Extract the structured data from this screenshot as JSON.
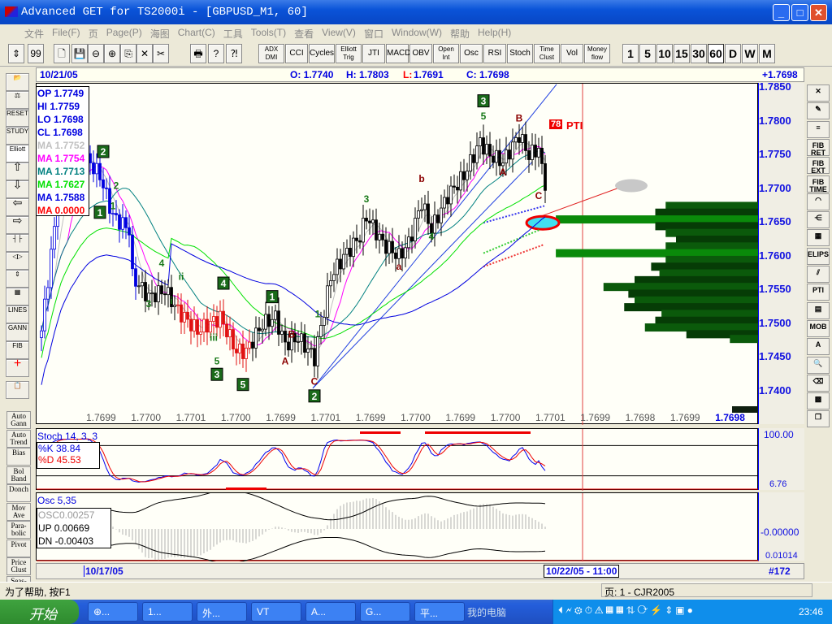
{
  "window": {
    "title": "Advanced GET for TS2000i - [GBPUSD_M1, 60]"
  },
  "menu": [
    "文件",
    "File(F)",
    "页",
    "Page(P)",
    "海图",
    "Chart(C)",
    "工具",
    "Tools(T)",
    "查看",
    "View(V)",
    "窗口",
    "Window(W)",
    "帮助",
    "Help(H)"
  ],
  "toolbar": {
    "indicators": [
      "ADX DMI",
      "CCI",
      "Cycles",
      "Elliott Trig",
      "JTI",
      "MACD",
      "OBV",
      "Open Int",
      "Osc",
      "RSI",
      "Stoch",
      "Time Clust",
      "Vol",
      "Money flow"
    ],
    "periods": [
      "1",
      "5",
      "10",
      "15",
      "30",
      "60",
      "D",
      "W",
      "M"
    ],
    "active_period": "60"
  },
  "info": {
    "date": "10/21/05",
    "open": "O: 1.7740",
    "high": "H: 1.7803",
    "low_label": "L:",
    "low": "1.7691",
    "close": "C: 1.7698",
    "change": "+1.7698"
  },
  "legend": [
    {
      "label": "OP 1.7749",
      "color": "#0000e0"
    },
    {
      "label": "HI  1.7759",
      "color": "#0000e0"
    },
    {
      "label": "LO  1.7698",
      "color": "#0000e0"
    },
    {
      "label": "CL  1.7698",
      "color": "#0000e0"
    },
    {
      "label": "MA 1.7752",
      "color": "#c0c0c0"
    },
    {
      "label": "MA 1.7754",
      "color": "#ff00ff"
    },
    {
      "label": "MA 1.7713",
      "color": "#008080"
    },
    {
      "label": "MA 1.7627",
      "color": "#00e000"
    },
    {
      "label": "MA 1.7588",
      "color": "#0000e0"
    },
    {
      "label": "MA 0.0000",
      "color": "#ff0000"
    }
  ],
  "left_tools": [
    "Elliott",
    "LINES",
    "GANN",
    "FIB",
    "RESET",
    "STUDY"
  ],
  "left_studies": [
    "Auto Gann",
    "Auto Trend",
    "Bias",
    "Bol Band",
    "Donch",
    "Mov Ave",
    "Para- bolic",
    "Pivot",
    "Price Clust",
    "Seas-"
  ],
  "right_tools": [
    "FIB RET",
    "FIB EXT",
    "FIB TIME",
    "ELIPS",
    "PTI",
    "MOB",
    "A"
  ],
  "pti": {
    "value": "78",
    "label": "PTI"
  },
  "chart_data": {
    "type": "candlestick",
    "symbol": "GBPUSD_M1",
    "interval": "60",
    "ylim": [
      1.7375,
      1.786
    ],
    "price_ticks": [
      "1.7850",
      "1.7800",
      "1.7750",
      "1.7700",
      "1.7650",
      "1.7600",
      "1.7550",
      "1.7500",
      "1.7450",
      "1.7400"
    ],
    "close_keypoints": [
      [
        0,
        1.749
      ],
      [
        5,
        1.768
      ],
      [
        13,
        1.775
      ],
      [
        18,
        1.772
      ],
      [
        22,
        1.766
      ],
      [
        27,
        1.764
      ],
      [
        28,
        1.757
      ],
      [
        33,
        1.754
      ],
      [
        38,
        1.755
      ],
      [
        42,
        1.752
      ],
      [
        48,
        1.749
      ],
      [
        55,
        1.751
      ],
      [
        60,
        1.746
      ],
      [
        63,
        1.746
      ],
      [
        68,
        1.75
      ],
      [
        72,
        1.751
      ],
      [
        75,
        1.747
      ],
      [
        79,
        1.748
      ],
      [
        84,
        1.745
      ],
      [
        87,
        1.752
      ],
      [
        89,
        1.757
      ],
      [
        93,
        1.76
      ],
      [
        98,
        1.763
      ],
      [
        100,
        1.766
      ],
      [
        105,
        1.762
      ],
      [
        110,
        1.76
      ],
      [
        113,
        1.762
      ],
      [
        117,
        1.768
      ],
      [
        120,
        1.764
      ],
      [
        125,
        1.769
      ],
      [
        130,
        1.772
      ],
      [
        135,
        1.777
      ],
      [
        138,
        1.775
      ],
      [
        142,
        1.774
      ],
      [
        147,
        1.778
      ],
      [
        150,
        1.775
      ],
      [
        153,
        1.776
      ],
      [
        155,
        1.7698
      ]
    ],
    "ma_periods": [
      5,
      9,
      22,
      45,
      70
    ],
    "wave_labels": [
      {
        "t": "2",
        "bar": 19,
        "p": 1.7755,
        "box": true
      },
      {
        "t": "1",
        "bar": 18,
        "p": 1.7665,
        "box": true
      },
      {
        "t": "1",
        "bar": 22,
        "p": 1.7675,
        "box": false
      },
      {
        "t": "2",
        "bar": 23,
        "p": 1.7705,
        "box": false
      },
      {
        "t": "4",
        "bar": 37,
        "p": 1.759,
        "box": false
      },
      {
        "t": "ii",
        "bar": 43,
        "p": 1.757,
        "box": false
      },
      {
        "t": "3",
        "bar": 33,
        "p": 1.753,
        "box": false
      },
      {
        "t": "i",
        "bar": 40,
        "p": 1.7535,
        "box": false
      },
      {
        "t": "4",
        "bar": 56,
        "p": 1.756,
        "box": true
      },
      {
        "t": "iii",
        "bar": 53,
        "p": 1.748,
        "box": false
      },
      {
        "t": "5",
        "bar": 54,
        "p": 1.7445,
        "box": false
      },
      {
        "t": "3",
        "bar": 54,
        "p": 1.7425,
        "box": true
      },
      {
        "t": "5",
        "bar": 62,
        "p": 1.741,
        "box": true
      },
      {
        "t": "1",
        "bar": 71,
        "p": 1.754,
        "box": true
      },
      {
        "t": "B",
        "bar": 77,
        "p": 1.7485,
        "box": false
      },
      {
        "t": "A",
        "bar": 75,
        "p": 1.7445,
        "box": false
      },
      {
        "t": "1",
        "bar": 85,
        "p": 1.7515,
        "box": false
      },
      {
        "t": "C",
        "bar": 84,
        "p": 1.7415,
        "box": false
      },
      {
        "t": "2",
        "bar": 84,
        "p": 1.7393,
        "box": true
      },
      {
        "t": "3",
        "bar": 100,
        "p": 1.7685,
        "box": false
      },
      {
        "t": "a",
        "bar": 110,
        "p": 1.7585,
        "box": false
      },
      {
        "t": "4",
        "bar": 120,
        "p": 1.763,
        "box": false
      },
      {
        "t": "b",
        "bar": 117,
        "p": 1.7715,
        "box": false
      },
      {
        "t": "3",
        "bar": 136,
        "p": 1.783,
        "box": true
      },
      {
        "t": "5",
        "bar": 136,
        "p": 1.7808,
        "box": false
      },
      {
        "t": "A",
        "bar": 142,
        "p": 1.7725,
        "box": false
      },
      {
        "t": "B",
        "bar": 147,
        "p": 1.7805,
        "box": false
      },
      {
        "t": "C",
        "bar": 153,
        "p": 1.769,
        "box": false
      }
    ],
    "volume_profile": [
      [
        1.7675,
        0.45
      ],
      [
        1.7665,
        0.5
      ],
      [
        1.7655,
        0.98
      ],
      [
        1.7645,
        0.5
      ],
      [
        1.7635,
        0.45
      ],
      [
        1.7625,
        0.4
      ],
      [
        1.7615,
        0.45
      ],
      [
        1.7605,
        0.98
      ],
      [
        1.7595,
        0.45
      ],
      [
        1.7585,
        0.52
      ],
      [
        1.7575,
        0.48
      ],
      [
        1.7565,
        0.6
      ],
      [
        1.7555,
        0.75
      ],
      [
        1.7545,
        0.63
      ],
      [
        1.7535,
        0.6
      ],
      [
        1.7525,
        0.65
      ],
      [
        1.7515,
        0.47
      ],
      [
        1.7505,
        0.5
      ],
      [
        1.7495,
        0.55
      ],
      [
        1.7485,
        0.35
      ],
      [
        1.7478,
        0.14
      ]
    ]
  },
  "bottom_prices": [
    "1.7699",
    "1.7700",
    "1.7701",
    "1.7700",
    "1.7699",
    "1.7701",
    "1.7699",
    "1.7700",
    "1.7699",
    "1.7700",
    "1.7701",
    "1.7699",
    "1.7698",
    "1.7699",
    "1.7698"
  ],
  "stoch": {
    "title": "Stoch 14, 3, 3",
    "k": "%K  38.84",
    "d": "%D  45.53",
    "top": "100.00",
    "bottom": "6.76"
  },
  "osc": {
    "title": "Osc 5,35",
    "osc": "OSC0.00257",
    "up": "UP  0.00669",
    "dn": "DN  -0.00403",
    "mid": "-0.00000",
    "bottom": "0.01014"
  },
  "dates": {
    "start": "10/17/05",
    "cursor": "10/22/05 - 11:00",
    "bar_count": "#172"
  },
  "status": {
    "help": "为了帮助, 按F1",
    "page": "页: 1 - CJR2005"
  },
  "taskbar": {
    "start": "开始",
    "items": [
      "⊕...",
      "1...",
      "外...",
      "VT",
      "A...",
      "G...",
      "平..."
    ],
    "my_computer": "我的电脑",
    "clock": "23:46"
  }
}
